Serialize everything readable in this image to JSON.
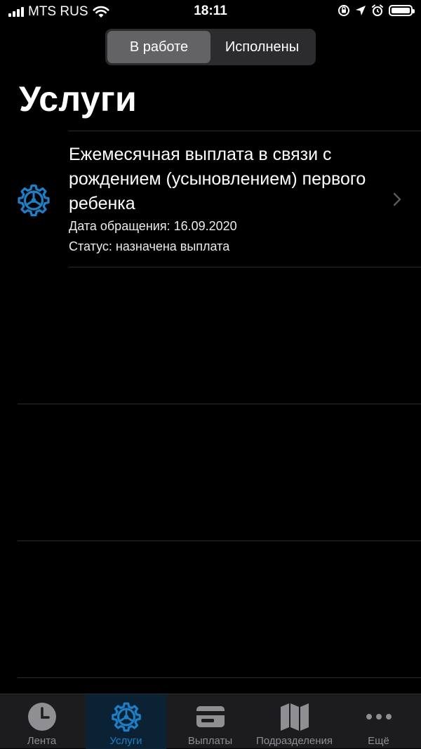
{
  "status_bar": {
    "carrier": "MTS RUS",
    "time": "18:11"
  },
  "segments": [
    {
      "label": "В работе",
      "active": true
    },
    {
      "label": "Исполнены",
      "active": false
    }
  ],
  "page_title": "Услуги",
  "items": [
    {
      "icon": "gear-icon",
      "title": "Ежемесячная выплата в связи с рождением (усыновлением) первого ребенка",
      "date": "Дата обращения: 16.09.2020",
      "status": "Статус: назначена выплата"
    }
  ],
  "tabs": [
    {
      "label": "Лента",
      "icon": "clock-icon",
      "active": false
    },
    {
      "label": "Услуги",
      "icon": "gear-icon",
      "active": true
    },
    {
      "label": "Выплаты",
      "icon": "card-icon",
      "active": false
    },
    {
      "label": "Подразделения",
      "icon": "map-icon",
      "active": false
    },
    {
      "label": "Ещё",
      "icon": "more-icon",
      "active": false
    }
  ],
  "colors": {
    "accent": "#1f7fc6",
    "background": "#000000",
    "tab_bar": "#1c1c1e",
    "inactive": "#8e8e93"
  }
}
